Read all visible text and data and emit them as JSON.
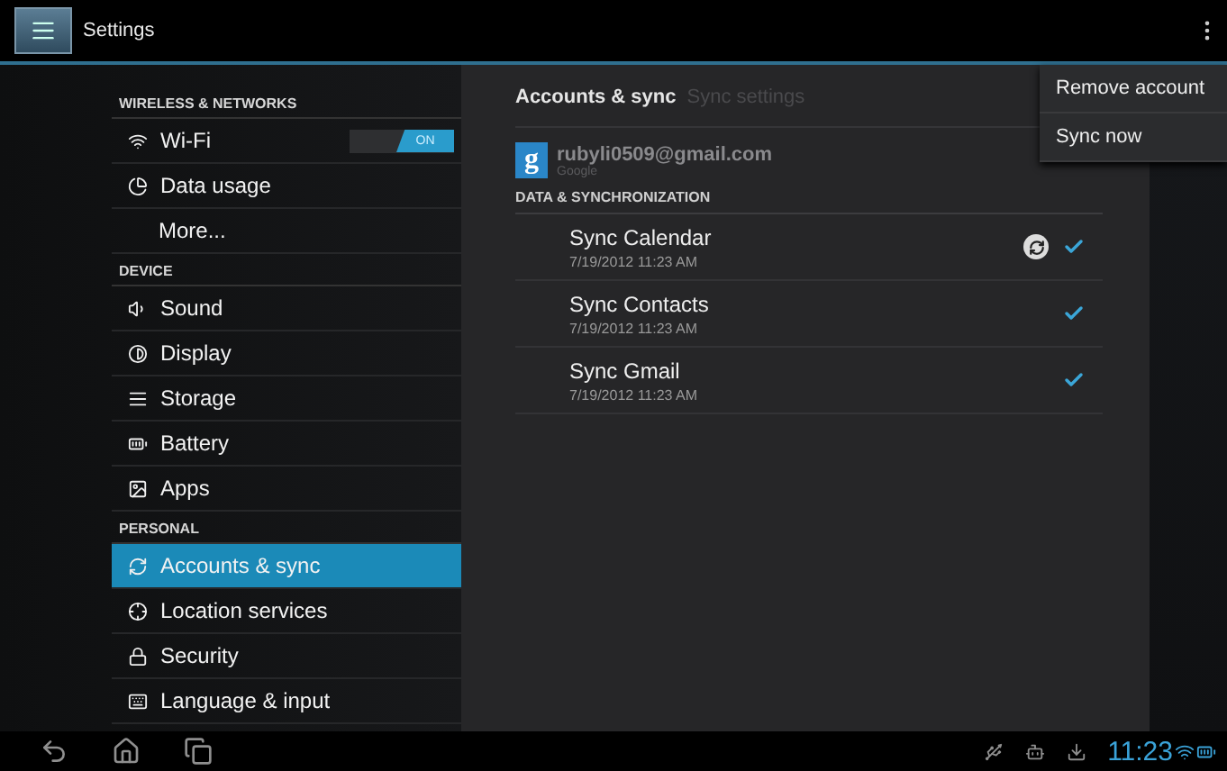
{
  "action_bar": {
    "title": "Settings"
  },
  "sidebar": {
    "sections": [
      {
        "header": "WIRELESS & NETWORKS",
        "items": [
          {
            "label": "Wi-Fi",
            "selected": false,
            "toggle": {
              "label": "ON",
              "on": true
            }
          },
          {
            "label": "Data usage",
            "selected": false
          },
          {
            "label": "More...",
            "selected": false
          }
        ]
      },
      {
        "header": "DEVICE",
        "items": [
          {
            "label": "Sound",
            "selected": false
          },
          {
            "label": "Display",
            "selected": false
          },
          {
            "label": "Storage",
            "selected": false
          },
          {
            "label": "Battery",
            "selected": false
          },
          {
            "label": "Apps",
            "selected": false
          }
        ]
      },
      {
        "header": "PERSONAL",
        "items": [
          {
            "label": "Accounts & sync",
            "selected": true
          },
          {
            "label": "Location services",
            "selected": false
          },
          {
            "label": "Security",
            "selected": false
          },
          {
            "label": "Language & input",
            "selected": false
          }
        ]
      }
    ]
  },
  "detail": {
    "breadcrumb": "Accounts & sync",
    "subtitle": "Sync settings",
    "account": {
      "logo": "g",
      "email": "rubyli0509@gmail.com",
      "type": "Google"
    },
    "section_header": "DATA & SYNCHRONIZATION",
    "rows": [
      {
        "title": "Sync Calendar",
        "date": "7/19/2012 11:23 AM",
        "syncing": true,
        "checked": true
      },
      {
        "title": "Sync Contacts",
        "date": "7/19/2012 11:23 AM",
        "syncing": false,
        "checked": true
      },
      {
        "title": "Sync Gmail",
        "date": "7/19/2012 11:23 AM",
        "syncing": false,
        "checked": true
      }
    ]
  },
  "menu": {
    "items": [
      "Remove account",
      "Sync now"
    ]
  },
  "status_bar": {
    "time": "11:23"
  }
}
